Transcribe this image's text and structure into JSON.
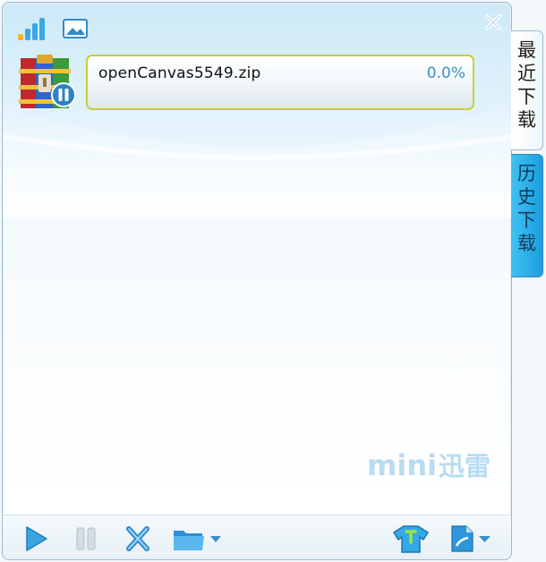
{
  "download": {
    "filename": "openCanvas5549.zip",
    "progress": "0.0%",
    "progress_fraction": 0.0,
    "state": "paused",
    "file_icon": "winrar-archive-icon",
    "state_icon": "pause-badge-icon"
  },
  "tabs": {
    "recent": [
      "最",
      "近",
      "下",
      "载"
    ],
    "history": [
      "历",
      "史",
      "下",
      "载"
    ]
  },
  "branding": {
    "logo_prefix": "mini",
    "logo_suffix": "迅雷"
  },
  "icons": {
    "titlebar": [
      "signal-bars-icon",
      "picture-icon",
      "close-icon"
    ],
    "toolbar_left": [
      "play-icon",
      "pause-icon",
      "delete-icon",
      "folder-icon",
      "dropdown-arrow-icon"
    ],
    "toolbar_right": [
      "skin-shirt-icon",
      "new-task-icon",
      "dropdown-arrow-icon"
    ]
  },
  "colors": {
    "accent": "#1d9fe0",
    "item_border": "#c6cf3b",
    "progress_text": "#3a8fc7",
    "logo": "#b8dcf2"
  }
}
